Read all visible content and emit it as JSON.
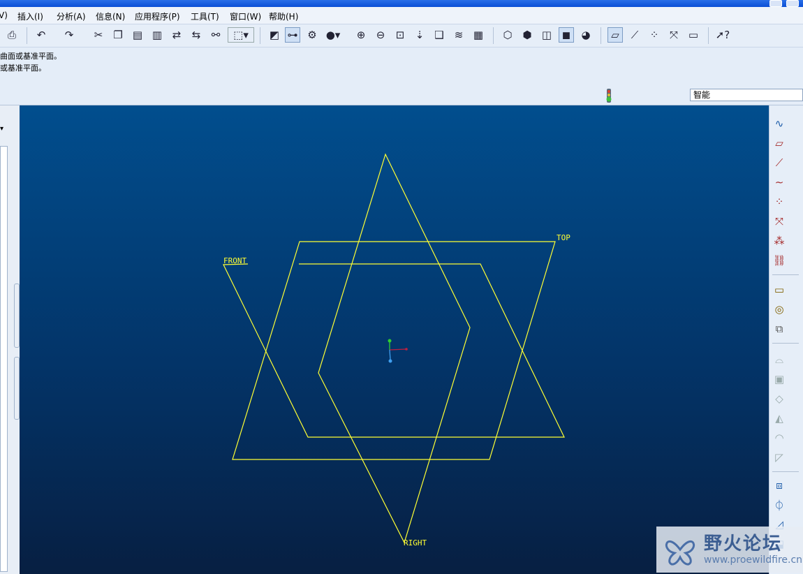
{
  "menu": {
    "items": [
      {
        "label": "V)"
      },
      {
        "label": "插入(I)"
      },
      {
        "label": "分析(A)"
      },
      {
        "label": "信息(N)"
      },
      {
        "label": "应用程序(P)"
      },
      {
        "label": "工具(T)"
      },
      {
        "label": "窗口(W)"
      },
      {
        "label": "帮助(H)"
      }
    ]
  },
  "messages": {
    "line1": "曲面或基准平面。",
    "line2": "或基准平面。"
  },
  "status": {
    "filter_value": "智能"
  },
  "graphics": {
    "datum_labels": {
      "front": "FRONT",
      "top": "TOP",
      "right": "RIGHT"
    },
    "colors": {
      "datum": "#ffff33",
      "bg_top": "#014e8e",
      "bg_bottom": "#071f42"
    }
  },
  "watermark": {
    "title": "野火论坛",
    "url": "www.proewildfire.cn"
  },
  "icons": {
    "toolbar": [
      "print-icon",
      "undo-icon",
      "redo-icon",
      "cut-icon",
      "copy-icon",
      "paste-icon",
      "paste-special-icon",
      "regenerate-icon",
      "regen-manager-icon",
      "find-icon",
      "select-box-icon",
      "repaint-icon",
      "spin-center-icon",
      "orient-icon",
      "appearance-icon",
      "zoom-in-icon",
      "zoom-out-icon",
      "refit-icon",
      "reorient-icon",
      "saved-views-icon",
      "layers-icon",
      "view-manager-icon",
      "wireframe-icon",
      "hidden-line-icon",
      "no-hidden-icon",
      "shading-icon",
      "model-tree-toggle-icon",
      "datum-planes-icon",
      "datum-axes-icon",
      "datum-points-icon",
      "coordinate-systems-icon",
      "annotation-icon",
      "whats-this-icon"
    ],
    "right": [
      "sketch-icon",
      "plane-icon",
      "axis-icon",
      "curve-icon",
      "point-icon",
      "csys-icon",
      "analysis-icon",
      "copy-geom-icon",
      "extrude-icon",
      "revolve-icon",
      "sweep-icon",
      "hole-icon",
      "shell-icon",
      "rib-icon",
      "draft-icon",
      "round-icon",
      "chamfer-icon",
      "pattern-icon",
      "mirror-icon",
      "trim-icon",
      "merge-icon"
    ]
  }
}
